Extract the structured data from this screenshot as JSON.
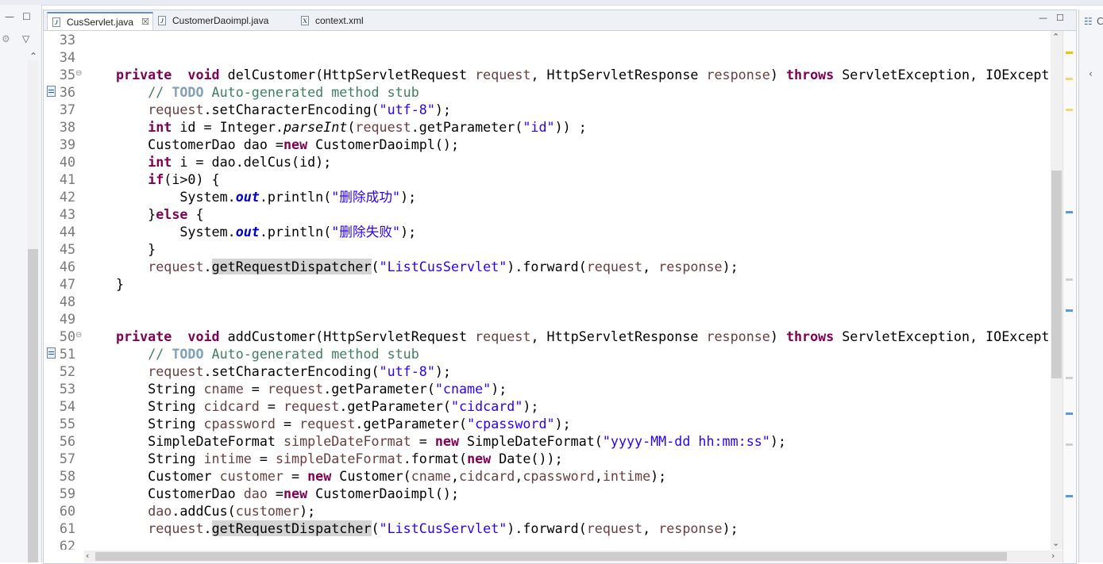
{
  "tabs": [
    {
      "name": "CusServlet.java",
      "icon": "J",
      "close": "☒"
    },
    {
      "name": "CustomerDaoimpl.java",
      "icon": "J"
    },
    {
      "name": "context.xml",
      "icon": "X"
    }
  ],
  "win_controls": {
    "minimize": "—",
    "maximize": "☐"
  },
  "left_panel": {
    "minimize": "—",
    "maximize": "☐",
    "menu": "▽"
  },
  "right_panel": {
    "label": "C",
    "chevron": "‹"
  },
  "arrows": {
    "up": "⌃",
    "down": "⌄",
    "left": "‹",
    "right": "›"
  },
  "colors": {
    "keyword": "#7f0055",
    "string": "#2a00ff",
    "comment": "#3f7f5f",
    "todo": "#7f9fbf",
    "field": "#0000c0",
    "param": "#6a3e3e"
  },
  "lines": [
    {
      "n": "33",
      "tokens": []
    },
    {
      "n": "34",
      "tokens": []
    },
    {
      "n": "35",
      "fold": "⊖",
      "tokens": [
        [
          "kw",
          "private"
        ],
        [
          "",
          "  "
        ],
        [
          "kw",
          "void"
        ],
        [
          "",
          " delCustomer(HttpServletRequest "
        ],
        [
          "par",
          "request"
        ],
        [
          "",
          ", HttpServletResponse "
        ],
        [
          "par",
          "response"
        ],
        [
          "",
          ") "
        ],
        [
          "kw",
          "throws"
        ],
        [
          "",
          " ServletException, IOExceptio"
        ]
      ]
    },
    {
      "n": "36",
      "marker": true,
      "tokens": [
        [
          "",
          "    "
        ],
        [
          "cmt",
          "// "
        ],
        [
          "todo",
          "TODO"
        ],
        [
          "cmt",
          " Auto-generated method stub"
        ]
      ]
    },
    {
      "n": "37",
      "tokens": [
        [
          "",
          "    "
        ],
        [
          "par",
          "request"
        ],
        [
          "",
          ".setCharacterEncoding("
        ],
        [
          "str",
          "\"utf-8\""
        ],
        [
          "",
          ");"
        ]
      ]
    },
    {
      "n": "38",
      "tokens": [
        [
          "",
          "    "
        ],
        [
          "kw",
          "int"
        ],
        [
          "",
          " id = Integer."
        ],
        [
          "it",
          "parseInt"
        ],
        [
          "",
          "("
        ],
        [
          "par",
          "request"
        ],
        [
          "",
          ".getParameter("
        ],
        [
          "str",
          "\"id\""
        ],
        [
          "",
          "))"
        ],
        [
          "",
          " ;"
        ]
      ]
    },
    {
      "n": "39",
      "tokens": [
        [
          "",
          "    CustomerDao dao ="
        ],
        [
          "kw",
          "new"
        ],
        [
          "",
          " CustomerDaoimpl();"
        ]
      ]
    },
    {
      "n": "40",
      "tokens": [
        [
          "",
          "    "
        ],
        [
          "kw",
          "int"
        ],
        [
          "",
          " i = dao.delCus(id);"
        ]
      ]
    },
    {
      "n": "41",
      "tokens": [
        [
          "",
          "    "
        ],
        [
          "kw",
          "if"
        ],
        [
          "",
          "(i>0) {"
        ]
      ]
    },
    {
      "n": "42",
      "tokens": [
        [
          "",
          "        System."
        ],
        [
          "fld",
          "out"
        ],
        [
          "",
          ".println("
        ],
        [
          "str",
          "\"删除成功\""
        ],
        [
          "",
          ");"
        ]
      ]
    },
    {
      "n": "43",
      "tokens": [
        [
          "",
          "    }"
        ],
        [
          "kw",
          "else"
        ],
        [
          "",
          " {"
        ]
      ]
    },
    {
      "n": "44",
      "tokens": [
        [
          "",
          "        System."
        ],
        [
          "fld",
          "out"
        ],
        [
          "",
          ".println("
        ],
        [
          "str",
          "\"删除失败\""
        ],
        [
          "",
          ");"
        ]
      ]
    },
    {
      "n": "45",
      "tokens": [
        [
          "",
          "    }"
        ]
      ]
    },
    {
      "n": "46",
      "tokens": [
        [
          "",
          "    "
        ],
        [
          "par",
          "request"
        ],
        [
          "",
          "."
        ],
        [
          "hl",
          "getRequestDispatcher"
        ],
        [
          "",
          "("
        ],
        [
          "str",
          "\"ListCusServlet\""
        ],
        [
          "",
          ").forward("
        ],
        [
          "par",
          "request"
        ],
        [
          "",
          ", "
        ],
        [
          "par",
          "response"
        ],
        [
          "",
          ");"
        ]
      ]
    },
    {
      "n": "47",
      "tokens": [
        [
          "",
          "}"
        ]
      ]
    },
    {
      "n": "48",
      "tokens": []
    },
    {
      "n": "49",
      "tokens": []
    },
    {
      "n": "50",
      "fold": "⊖",
      "tokens": [
        [
          "kw",
          "private"
        ],
        [
          "",
          "  "
        ],
        [
          "kw",
          "void"
        ],
        [
          "",
          " addCustomer(HttpServletRequest "
        ],
        [
          "par",
          "request"
        ],
        [
          "",
          ", HttpServletResponse "
        ],
        [
          "par",
          "response"
        ],
        [
          "",
          ") "
        ],
        [
          "kw",
          "throws"
        ],
        [
          "",
          " ServletException, IOExceptio"
        ]
      ]
    },
    {
      "n": "51",
      "marker": true,
      "tokens": [
        [
          "",
          "    "
        ],
        [
          "cmt",
          "// "
        ],
        [
          "todo",
          "TODO"
        ],
        [
          "cmt",
          " Auto-generated method stub"
        ]
      ]
    },
    {
      "n": "52",
      "tokens": [
        [
          "",
          "    "
        ],
        [
          "par",
          "request"
        ],
        [
          "",
          ".setCharacterEncoding("
        ],
        [
          "str",
          "\"utf-8\""
        ],
        [
          "",
          ");"
        ]
      ]
    },
    {
      "n": "53",
      "tokens": [
        [
          "",
          "    String "
        ],
        [
          "par",
          "cname"
        ],
        [
          "",
          " = "
        ],
        [
          "par",
          "request"
        ],
        [
          "",
          ".getParameter("
        ],
        [
          "str",
          "\"cname\""
        ],
        [
          "",
          ");"
        ]
      ]
    },
    {
      "n": "54",
      "tokens": [
        [
          "",
          "    String "
        ],
        [
          "par",
          "cidcard"
        ],
        [
          "",
          " = "
        ],
        [
          "par",
          "request"
        ],
        [
          "",
          ".getParameter("
        ],
        [
          "str",
          "\"cidcard\""
        ],
        [
          "",
          ");"
        ]
      ]
    },
    {
      "n": "55",
      "tokens": [
        [
          "",
          "    String "
        ],
        [
          "par",
          "cpassword"
        ],
        [
          "",
          " = "
        ],
        [
          "par",
          "request"
        ],
        [
          "",
          ".getParameter("
        ],
        [
          "str",
          "\"cpassword\""
        ],
        [
          "",
          ");"
        ]
      ]
    },
    {
      "n": "56",
      "tokens": [
        [
          "",
          "    SimpleDateFormat "
        ],
        [
          "par",
          "simpleDateFormat"
        ],
        [
          "",
          " = "
        ],
        [
          "kw",
          "new"
        ],
        [
          "",
          " SimpleDateFormat("
        ],
        [
          "str",
          "\"yyyy-MM-dd hh:mm:ss\""
        ],
        [
          "",
          ");"
        ]
      ]
    },
    {
      "n": "57",
      "tokens": [
        [
          "",
          "    String "
        ],
        [
          "par",
          "intime"
        ],
        [
          "",
          " = "
        ],
        [
          "par",
          "simpleDateFormat"
        ],
        [
          "",
          ".format("
        ],
        [
          "kw",
          "new"
        ],
        [
          "",
          " Date());"
        ]
      ]
    },
    {
      "n": "58",
      "tokens": [
        [
          "",
          "    Customer "
        ],
        [
          "par",
          "customer"
        ],
        [
          "",
          " = "
        ],
        [
          "kw",
          "new"
        ],
        [
          "",
          " Customer("
        ],
        [
          "par",
          "cname"
        ],
        [
          "",
          ","
        ],
        [
          "par",
          "cidcard"
        ],
        [
          "",
          ","
        ],
        [
          "par",
          "cpassword"
        ],
        [
          "",
          ","
        ],
        [
          "par",
          "intime"
        ],
        [
          "",
          ");"
        ]
      ]
    },
    {
      "n": "59",
      "tokens": [
        [
          "",
          "    CustomerDao "
        ],
        [
          "par",
          "dao"
        ],
        [
          "",
          " ="
        ],
        [
          "kw",
          "new"
        ],
        [
          "",
          " CustomerDaoimpl();"
        ]
      ]
    },
    {
      "n": "60",
      "tokens": [
        [
          "",
          "    "
        ],
        [
          "par",
          "dao"
        ],
        [
          "",
          ".addCus("
        ],
        [
          "par",
          "customer"
        ],
        [
          "",
          ");"
        ]
      ]
    },
    {
      "n": "61",
      "tokens": [
        [
          "",
          "    "
        ],
        [
          "par",
          "request"
        ],
        [
          "",
          "."
        ],
        [
          "hl",
          "getRequestDispatcher"
        ],
        [
          "",
          "("
        ],
        [
          "str",
          "\"ListCusServlet\""
        ],
        [
          "",
          ").forward("
        ],
        [
          "par",
          "request"
        ],
        [
          "",
          ", "
        ],
        [
          "par",
          "response"
        ],
        [
          "",
          ");"
        ]
      ]
    },
    {
      "n": "62",
      "tokens": []
    }
  ],
  "ruler_marks": [
    {
      "pos": 0.04,
      "color": "#f2c200"
    },
    {
      "pos": 0.09,
      "color": "#f2d870"
    },
    {
      "pos": 0.15,
      "color": "#f2d870"
    },
    {
      "pos": 0.35,
      "color": "#5b9bd5"
    },
    {
      "pos": 0.48,
      "color": "#d0d0d0"
    },
    {
      "pos": 0.54,
      "color": "#5b9bd5"
    },
    {
      "pos": 0.67,
      "color": "#d0d0d0"
    },
    {
      "pos": 0.74,
      "color": "#5b9bd5"
    },
    {
      "pos": 0.8,
      "color": "#d0d0d0"
    },
    {
      "pos": 0.9,
      "color": "#5b9bd5"
    }
  ]
}
